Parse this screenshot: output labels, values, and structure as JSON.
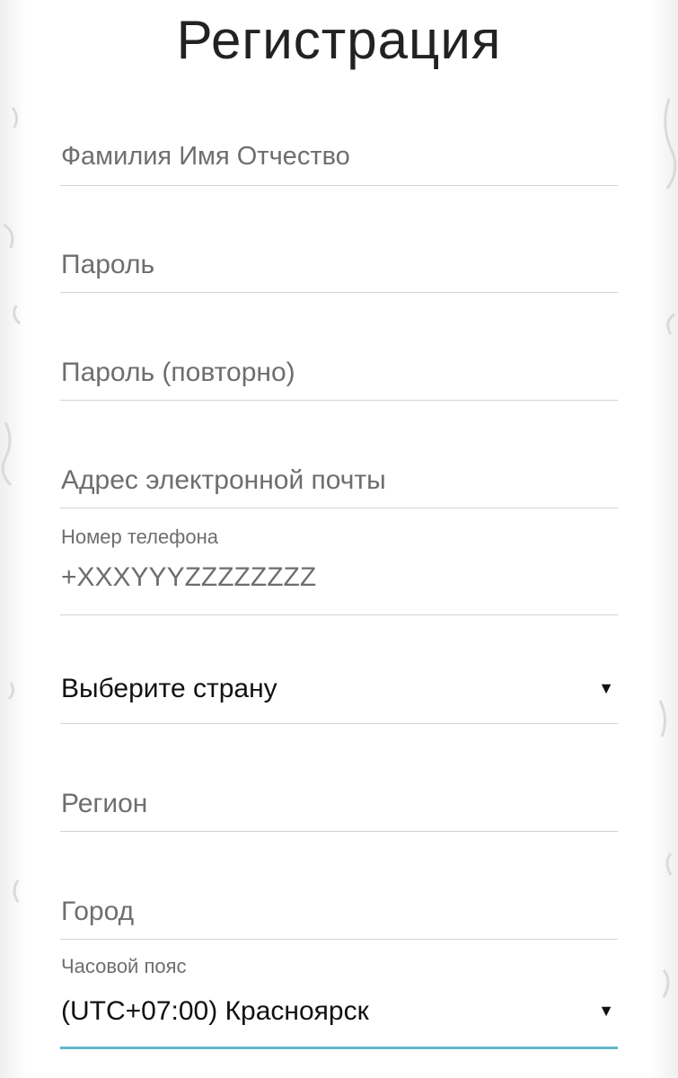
{
  "page": {
    "title": "Регистрация"
  },
  "form": {
    "full_name": {
      "placeholder": "Фамилия Имя Отчество"
    },
    "password": {
      "placeholder": "Пароль"
    },
    "password_repeat": {
      "placeholder": "Пароль (повторно)"
    },
    "email": {
      "placeholder": "Адрес электронной почты"
    },
    "phone": {
      "label": "Номер телефона",
      "value": "+XXXYYYZZZZZZZZ"
    },
    "country": {
      "value": "Выберите страну",
      "arrow": "▼"
    },
    "region": {
      "placeholder": "Регион"
    },
    "city": {
      "placeholder": "Город"
    },
    "timezone": {
      "label": "Часовой пояс",
      "value": "(UTC+07:00) Красноярск",
      "arrow": "▼"
    }
  },
  "colors": {
    "accent_underline": "#5fb8c8",
    "divider": "#d2d2d2",
    "placeholder_text": "#6e6e6e"
  }
}
